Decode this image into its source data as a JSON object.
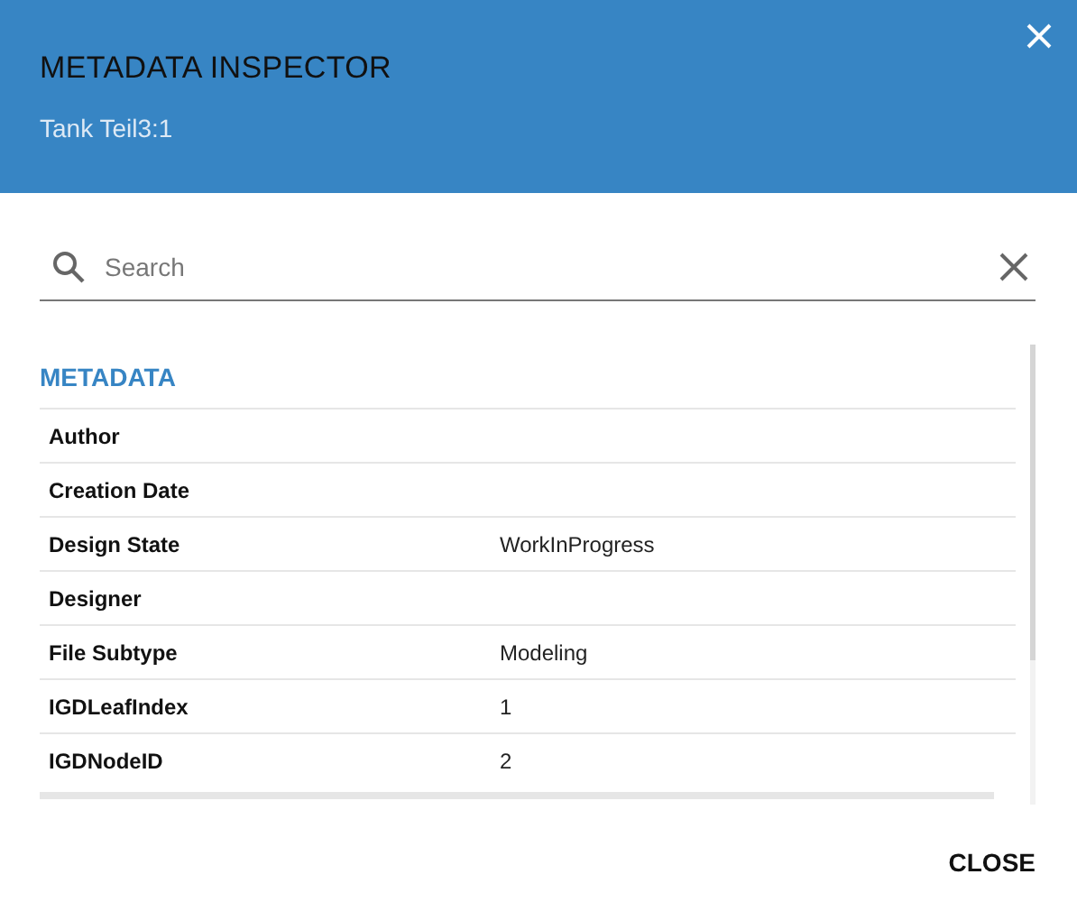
{
  "dialog": {
    "title": "METADATA INSPECTOR",
    "subtitle": "Tank Teil3:1"
  },
  "search": {
    "placeholder": "Search"
  },
  "section": {
    "title": "METADATA"
  },
  "rows": [
    {
      "label": "Author",
      "value": ""
    },
    {
      "label": "Creation Date",
      "value": ""
    },
    {
      "label": "Design State",
      "value": "WorkInProgress"
    },
    {
      "label": "Designer",
      "value": ""
    },
    {
      "label": "File Subtype",
      "value": "Modeling"
    },
    {
      "label": "IGDLeafIndex",
      "value": "1"
    },
    {
      "label": "IGDNodeID",
      "value": "2"
    }
  ],
  "buttons": [
    "CLOSE"
  ]
}
